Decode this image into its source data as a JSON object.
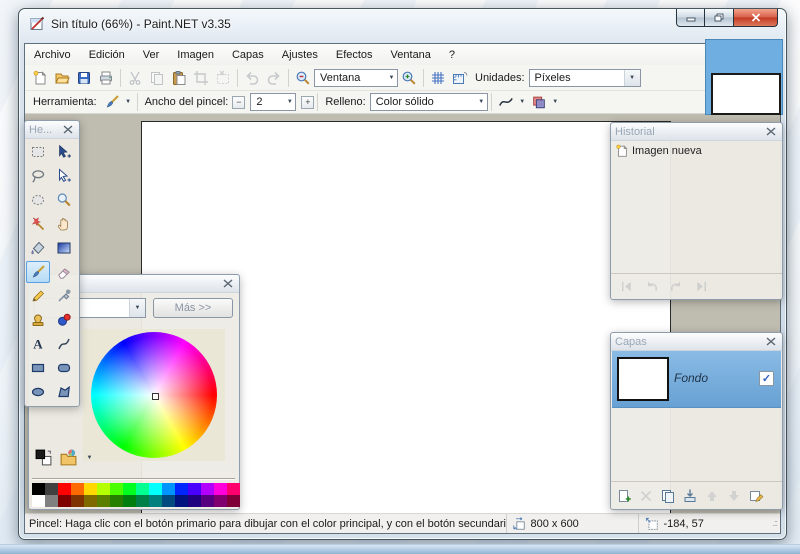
{
  "window": {
    "title": "Sin título (66%) - Paint.NET v3.35"
  },
  "menu": {
    "items": [
      "Archivo",
      "Edición",
      "Ver",
      "Imagen",
      "Capas",
      "Ajustes",
      "Efectos",
      "Ventana",
      "?"
    ]
  },
  "toolbar": {
    "zoom_dropdown_value": "Ventana",
    "units_label": "Unidades:",
    "units_value": "Píxeles",
    "tool_label": "Herramienta:",
    "width_label": "Ancho del pincel:",
    "width_value": "2",
    "fill_label": "Relleno:",
    "fill_value": "Color sólido"
  },
  "tools_panel": {
    "title": "He...",
    "selected": "paintbrush",
    "tools": [
      "rectangle-select",
      "move-selected-pixels",
      "lasso-select",
      "move-selection",
      "ellipse-select",
      "zoom",
      "magic-wand",
      "pan",
      "paint-bucket",
      "gradient",
      "paintbrush",
      "eraser",
      "pencil",
      "color-picker",
      "clone-stamp",
      "recolor",
      "text",
      "line-curve",
      "rectangle",
      "rounded-rectangle",
      "ellipse",
      "freeform-shape"
    ]
  },
  "colors_panel": {
    "more_button": "Más >>",
    "palette_row1": [
      "#000000",
      "#404040",
      "#FF0000",
      "#FF6A00",
      "#FFD800",
      "#B6FF00",
      "#4CFF00",
      "#00FF21",
      "#00FF90",
      "#00FFFF",
      "#0094FF",
      "#0026FF",
      "#4800FF",
      "#B200FF",
      "#FF00DC",
      "#FF006E"
    ],
    "palette_row2": [
      "#FFFFFF",
      "#808080",
      "#7F0000",
      "#7F3300",
      "#7F6A00",
      "#5B7F00",
      "#267F00",
      "#007F0E",
      "#007F46",
      "#007F7F",
      "#004A7F",
      "#00137F",
      "#21007F",
      "#57007F",
      "#7F006E",
      "#7F0037"
    ]
  },
  "history_panel": {
    "title": "Historial",
    "items": [
      {
        "label": "Imagen nueva"
      }
    ]
  },
  "layers_panel": {
    "title": "Capas",
    "layers": [
      {
        "name": "Fondo",
        "visible": true
      }
    ]
  },
  "status_bar": {
    "hint": "Pincel: Haga clic con el botón primario para dibujar con el color principal, y con el botón secundario p",
    "canvas_size": "800 x 600",
    "cursor_position": "-184, 57"
  },
  "colors": {
    "selection_blue": "#6FAEE0",
    "client_background": "#BFBCB0",
    "layer_selected_blue": "#79AEDD",
    "close_button_red": "#C33A22"
  }
}
